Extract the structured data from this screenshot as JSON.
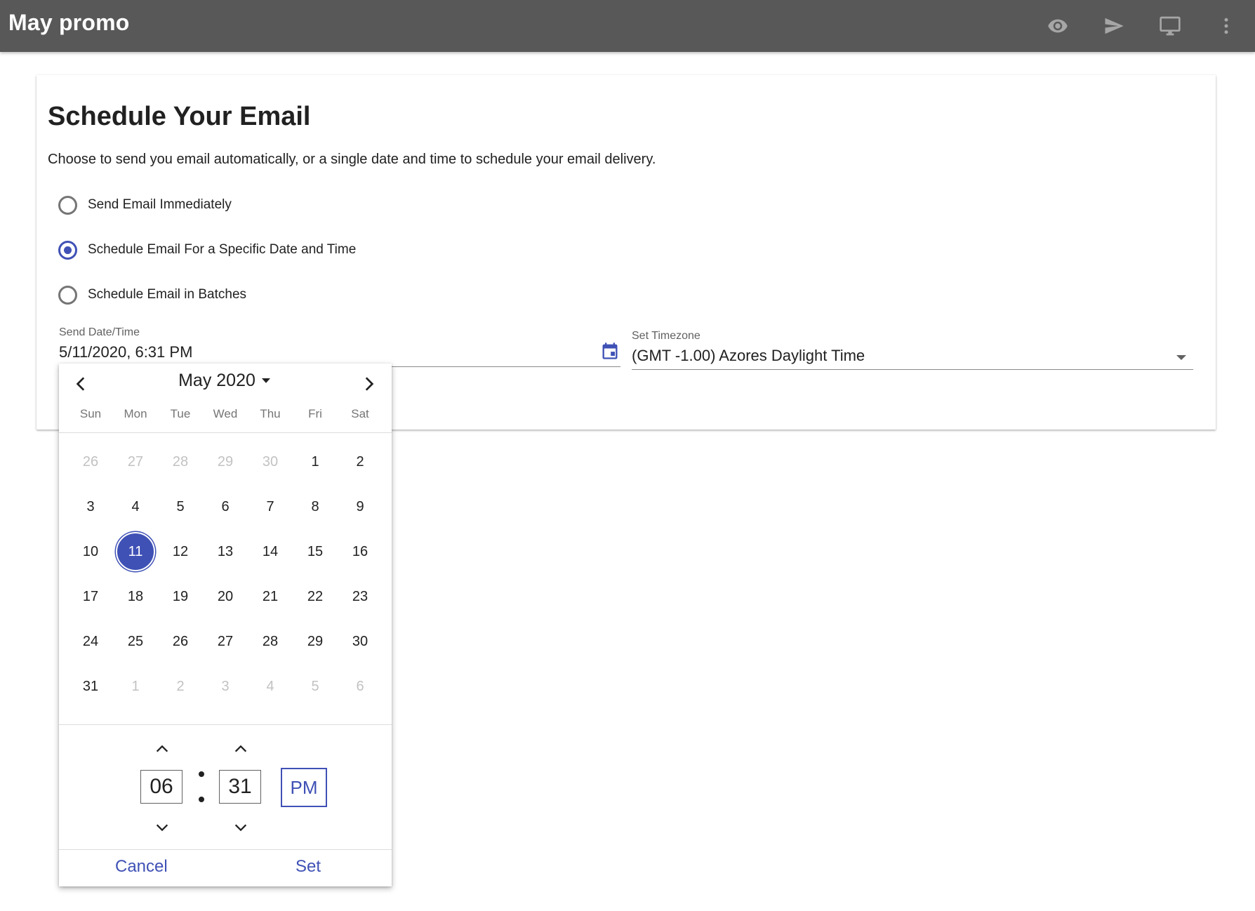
{
  "app": {
    "title": "May promo",
    "actions": [
      {
        "name": "preview",
        "icon": "eye-icon"
      },
      {
        "name": "send",
        "icon": "send-icon"
      },
      {
        "name": "desktop-preview",
        "icon": "monitor-icon"
      },
      {
        "name": "more",
        "icon": "more-vertical-icon"
      }
    ]
  },
  "colors": {
    "primary": "#3f51b5",
    "appbar": "#585858"
  },
  "schedule": {
    "heading": "Schedule Your Email",
    "description": "Choose to send you email automatically, or a single date and time to schedule your email delivery.",
    "options": [
      {
        "label": "Send Email Immediately",
        "checked": false
      },
      {
        "label": "Schedule Email For a Specific Date and Time",
        "checked": true
      },
      {
        "label": "Schedule Email in Batches",
        "checked": false
      }
    ],
    "send_datetime_label": "Send Date/Time",
    "send_datetime_value": "5/11/2020, 6:31 PM",
    "timezone_label": "Set Timezone",
    "timezone_value": "(GMT -1.00) Azores Daylight Time"
  },
  "picker": {
    "month_label": "May 2020",
    "weekdays": [
      "Sun",
      "Mon",
      "Tue",
      "Wed",
      "Thu",
      "Fri",
      "Sat"
    ],
    "weeks": [
      [
        {
          "d": "26",
          "o": true
        },
        {
          "d": "27",
          "o": true
        },
        {
          "d": "28",
          "o": true
        },
        {
          "d": "29",
          "o": true
        },
        {
          "d": "30",
          "o": true
        },
        {
          "d": "1"
        },
        {
          "d": "2"
        }
      ],
      [
        {
          "d": "3"
        },
        {
          "d": "4"
        },
        {
          "d": "5"
        },
        {
          "d": "6"
        },
        {
          "d": "7"
        },
        {
          "d": "8"
        },
        {
          "d": "9"
        }
      ],
      [
        {
          "d": "10"
        },
        {
          "d": "11",
          "sel": true
        },
        {
          "d": "12"
        },
        {
          "d": "13"
        },
        {
          "d": "14"
        },
        {
          "d": "15"
        },
        {
          "d": "16"
        }
      ],
      [
        {
          "d": "17"
        },
        {
          "d": "18"
        },
        {
          "d": "19"
        },
        {
          "d": "20"
        },
        {
          "d": "21"
        },
        {
          "d": "22"
        },
        {
          "d": "23"
        }
      ],
      [
        {
          "d": "24"
        },
        {
          "d": "25"
        },
        {
          "d": "26"
        },
        {
          "d": "27"
        },
        {
          "d": "28"
        },
        {
          "d": "29"
        },
        {
          "d": "30"
        }
      ],
      [
        {
          "d": "31"
        },
        {
          "d": "1",
          "o": true
        },
        {
          "d": "2",
          "o": true
        },
        {
          "d": "3",
          "o": true
        },
        {
          "d": "4",
          "o": true
        },
        {
          "d": "5",
          "o": true
        },
        {
          "d": "6",
          "o": true
        }
      ]
    ],
    "hour": "06",
    "minute": "31",
    "ampm": "PM",
    "cancel_label": "Cancel",
    "set_label": "Set"
  }
}
